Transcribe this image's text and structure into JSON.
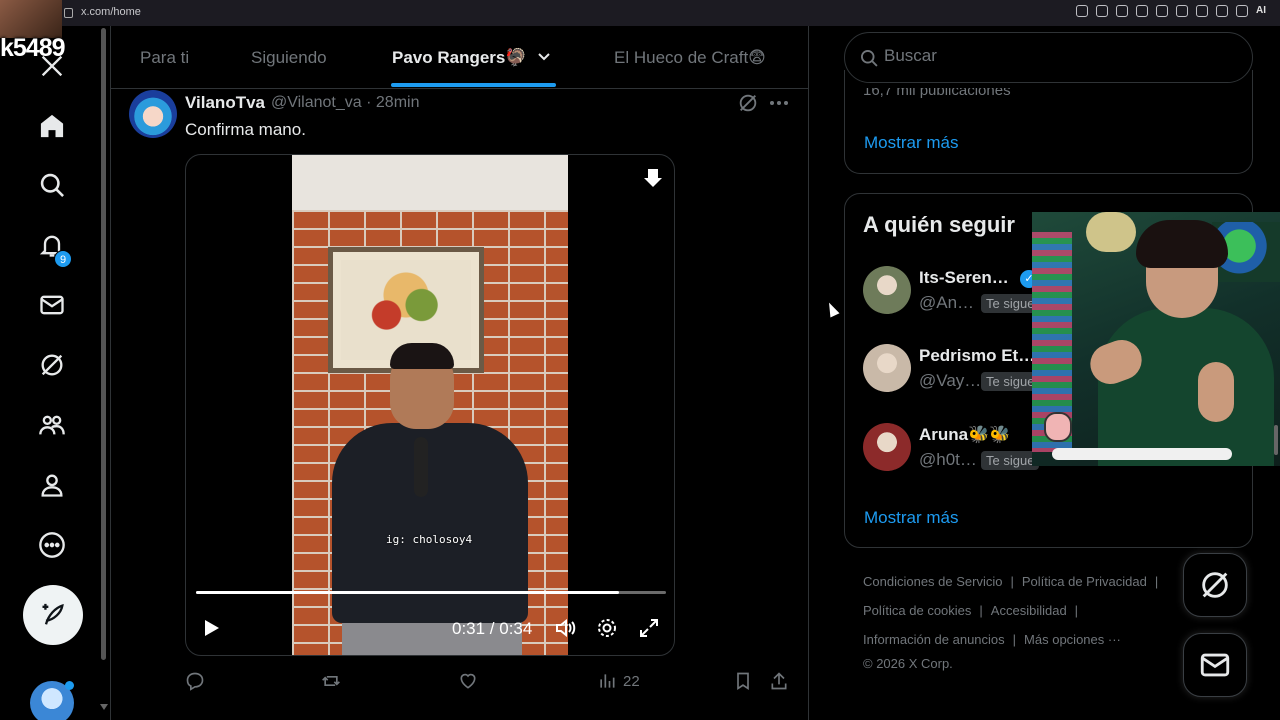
{
  "browser": {
    "url": "x.com/home",
    "ai_label": "AI"
  },
  "stream": {
    "counter": "k5489"
  },
  "nav": {
    "notifications_badge": "9"
  },
  "tabs": [
    {
      "label": "Para ti"
    },
    {
      "label": "Siguiendo"
    },
    {
      "label": "Pavo Rangers🦃"
    },
    {
      "label": "El Hueco de Craft😨"
    }
  ],
  "tweet": {
    "name": "VilanoTva",
    "handle_time": "@Vilanot_va · 28min",
    "text": "Confirma mano.",
    "video": {
      "watermark": "ig: cholosoy4",
      "time": "0:31 / 0:34",
      "progress": 0.9
    },
    "views": "22"
  },
  "search": {
    "placeholder": "Buscar"
  },
  "trends": {
    "cut_text": "16,7 mil publicaciones",
    "show_more": "Mostrar más"
  },
  "who_to_follow": {
    "title": "A quién seguir",
    "users": [
      {
        "name": "Its-Seren…",
        "handle": "@An…",
        "follows_you": "Te sigue",
        "verified": true,
        "avatar_color": "#6e7b5a"
      },
      {
        "name": "Pedrismo Et…",
        "handle": "@Vay…",
        "follows_you": "Te sigue",
        "verified": false,
        "avatar_color": "#c9b9a8"
      },
      {
        "name": "Aruna🐝🐝",
        "handle": "@h0t…",
        "follows_you": "Te sigue",
        "verified": false,
        "avatar_color": "#8c2a2a"
      }
    ],
    "show_more": "Mostrar más"
  },
  "footer": {
    "terms": "Condiciones de Servicio",
    "privacy": "Política de Privacidad",
    "cookies": "Política de cookies",
    "accessibility": "Accesibilidad",
    "ads_info": "Información de anuncios",
    "more_options": "Más opciones ···",
    "copyright": "© 2026 X Corp."
  },
  "colors": {
    "accent": "#1d9bf0",
    "background": "#000000",
    "border": "#2f3336",
    "muted": "#71767b"
  }
}
